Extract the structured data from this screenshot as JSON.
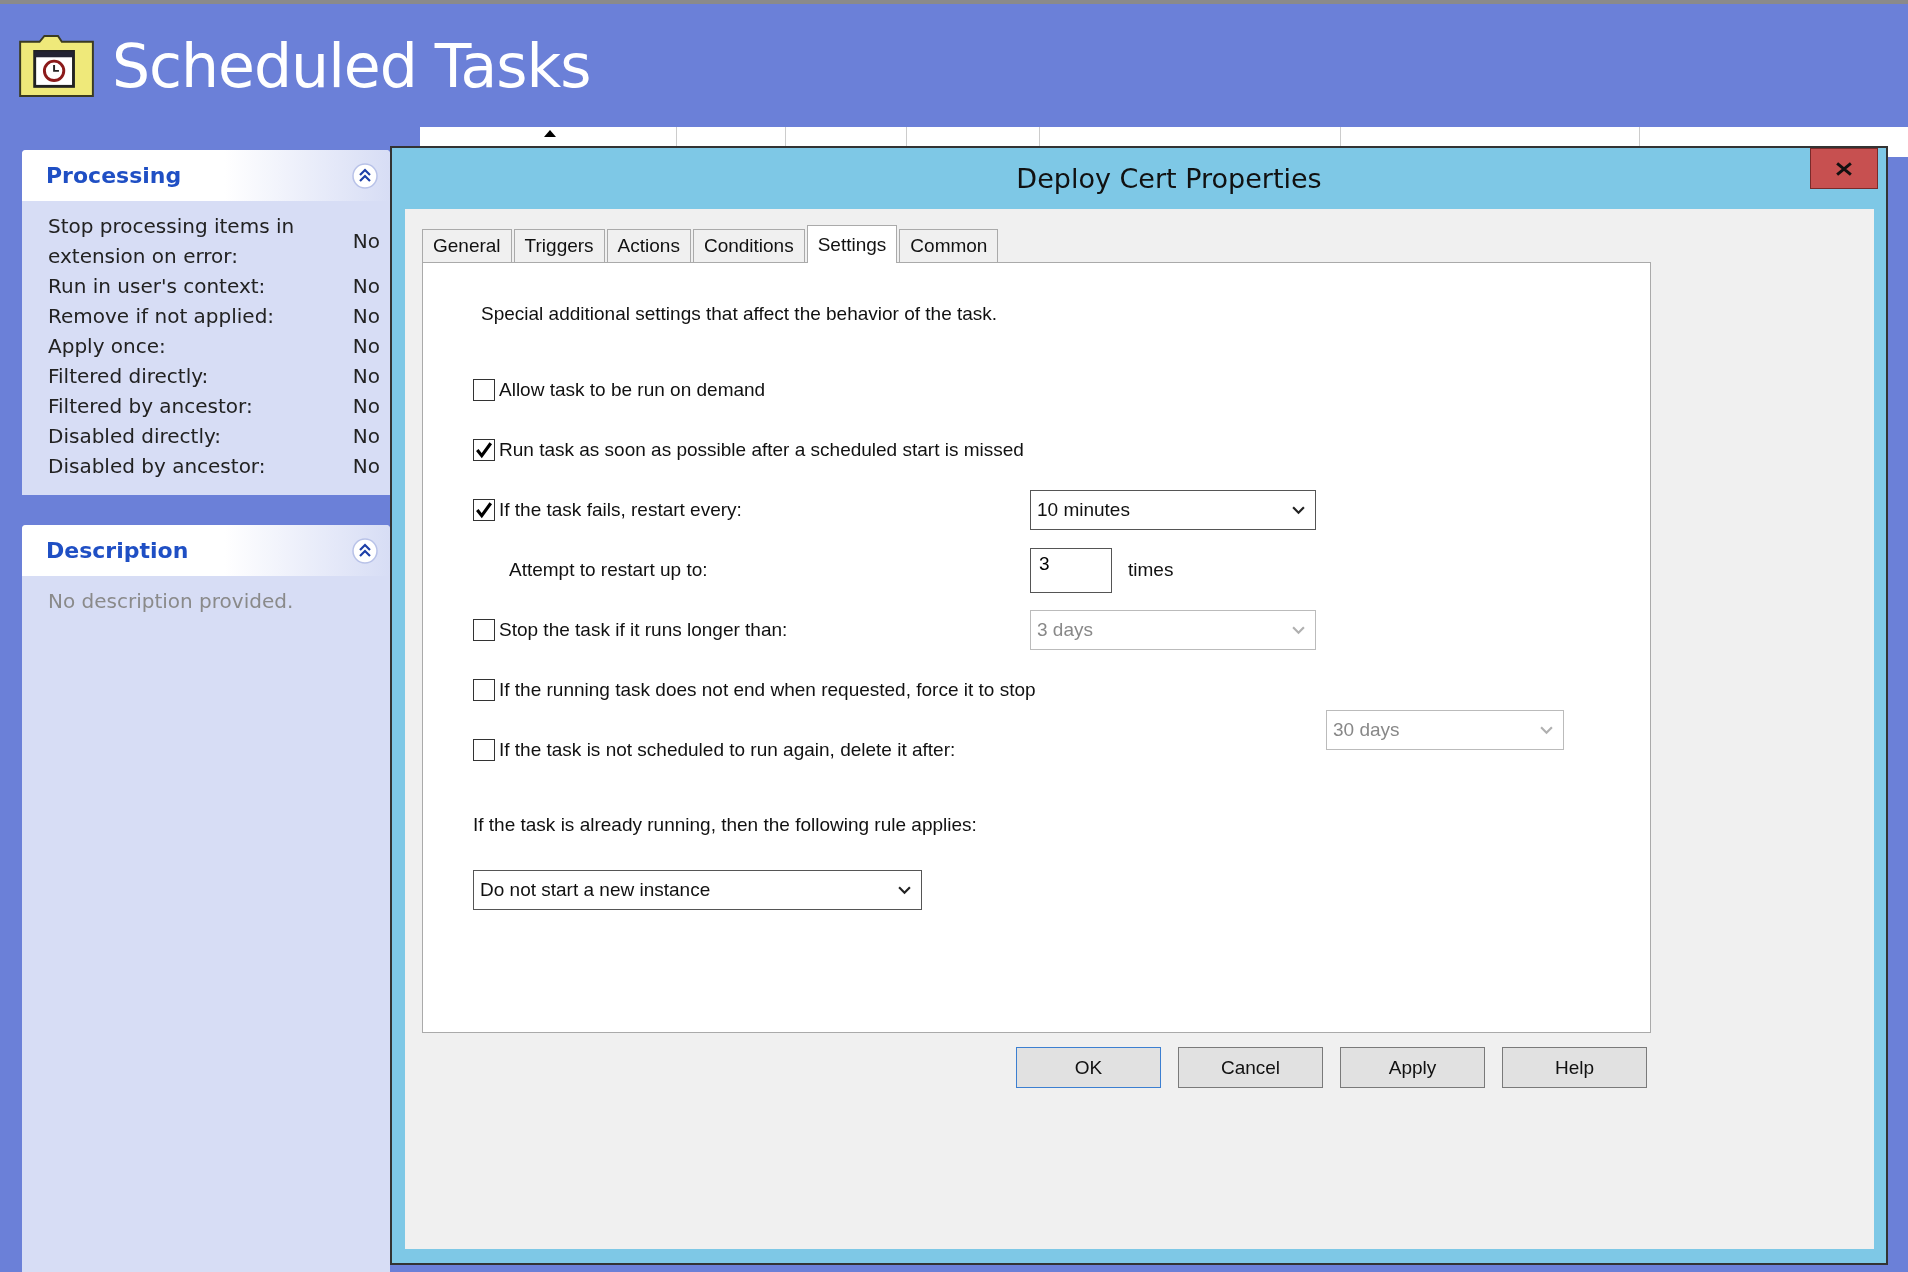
{
  "header": {
    "title": "Scheduled Tasks"
  },
  "sidebar": {
    "panels": [
      {
        "title": "Processing",
        "expanded": true,
        "rows": [
          {
            "label": "Stop processing items in extension on error:",
            "value": "No"
          },
          {
            "label": "Run in user's context:",
            "value": "No"
          },
          {
            "label": "Remove if not applied:",
            "value": "No"
          },
          {
            "label": "Apply once:",
            "value": "No"
          },
          {
            "label": "Filtered directly:",
            "value": "No"
          },
          {
            "label": "Filtered by ancestor:",
            "value": "No"
          },
          {
            "label": "Disabled directly:",
            "value": "No"
          },
          {
            "label": "Disabled by ancestor:",
            "value": "No"
          }
        ]
      },
      {
        "title": "Description",
        "expanded": true,
        "text": "No description provided."
      }
    ]
  },
  "dialog": {
    "title": "Deploy Cert Properties",
    "tabs": [
      {
        "label": "General",
        "selected": false
      },
      {
        "label": "Triggers",
        "selected": false
      },
      {
        "label": "Actions",
        "selected": false
      },
      {
        "label": "Conditions",
        "selected": false
      },
      {
        "label": "Settings",
        "selected": true
      },
      {
        "label": "Common",
        "selected": false
      }
    ],
    "intro": "Special additional settings that affect the behavior of the task.",
    "settings": [
      {
        "kind": "checkbox",
        "label": "Allow task to be run on demand",
        "checked": false
      },
      {
        "kind": "checkbox",
        "label": "Run task as soon as possible after a scheduled start is missed",
        "checked": true
      },
      {
        "kind": "checkbox",
        "label": "If the task fails, restart every:",
        "checked": true,
        "dropdown": {
          "value": "10 minutes",
          "disabled": false
        }
      },
      {
        "kind": "number",
        "label": "Attempt to restart up to:",
        "value": "3",
        "unit": "times"
      },
      {
        "kind": "checkbox",
        "label": "Stop the task if it runs longer than:",
        "checked": false,
        "dropdown": {
          "value": "3 days",
          "disabled": true
        }
      },
      {
        "kind": "checkbox",
        "label": "If the running task does not end when requested, force it to stop",
        "checked": false
      },
      {
        "kind": "checkbox",
        "label": "If the task is not scheduled to run again, delete it after:",
        "checked": false,
        "dropdown": {
          "value": "30 days",
          "disabled": true
        }
      },
      {
        "kind": "text",
        "label": "If the task is already running, then the following rule applies:"
      },
      {
        "kind": "dropdown",
        "value": "Do not start a new instance",
        "disabled": false
      }
    ],
    "buttons": [
      {
        "label": "OK",
        "default": true
      },
      {
        "label": "Cancel",
        "default": false
      },
      {
        "label": "Apply",
        "default": false
      },
      {
        "label": "Help",
        "default": false
      }
    ]
  }
}
